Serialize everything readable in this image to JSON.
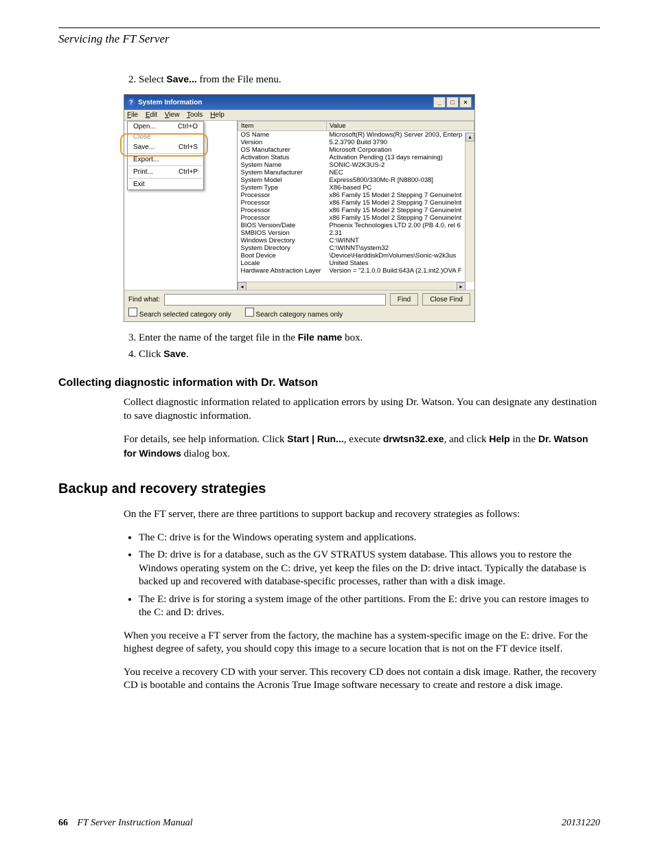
{
  "running_head": "Servicing the FT Server",
  "step2_prefix": "Select ",
  "step2_bold": "Save...",
  "step2_suffix": " from the File menu.",
  "screenshot": {
    "title": "System Information",
    "menus": [
      "File",
      "Edit",
      "View",
      "Tools",
      "Help"
    ],
    "file_menu": [
      {
        "label": "Open...",
        "accel": "Ctrl+O",
        "disabled": false
      },
      {
        "label": "Close",
        "accel": "",
        "disabled": true
      },
      {
        "label": "Save...",
        "accel": "Ctrl+S",
        "disabled": false
      },
      {
        "label": "Export...",
        "accel": "",
        "disabled": false
      },
      {
        "label": "Print...",
        "accel": "Ctrl+P",
        "disabled": false
      },
      {
        "label": "Exit",
        "accel": "",
        "disabled": false
      }
    ],
    "columns": [
      "Item",
      "Value"
    ],
    "rows": [
      [
        "OS Name",
        "Microsoft(R) Windows(R) Server 2003, Enterp"
      ],
      [
        "Version",
        "5.2.3790 Build 3790"
      ],
      [
        "OS Manufacturer",
        "Microsoft Corporation"
      ],
      [
        "Activation Status",
        "Activation Pending (13 days remaining)"
      ],
      [
        "System Name",
        "SONIC-W2K3US-2"
      ],
      [
        "System Manufacturer",
        "NEC"
      ],
      [
        "System Model",
        "Express5800/330Mc-R [N8800-038]"
      ],
      [
        "System Type",
        "X86-based PC"
      ],
      [
        "Processor",
        "x86 Family 15 Model 2 Stepping 7 GenuineInt"
      ],
      [
        "Processor",
        "x86 Family 15 Model 2 Stepping 7 GenuineInt"
      ],
      [
        "Processor",
        "x86 Family 15 Model 2 Stepping 7 GenuineInt"
      ],
      [
        "Processor",
        "x86 Family 15 Model 2 Stepping 7 GenuineInt"
      ],
      [
        "BIOS Version/Date",
        "Phoenix Technologies LTD 2.00 (PB 4.0, rel 6"
      ],
      [
        "SMBIOS Version",
        "2.31"
      ],
      [
        "Windows Directory",
        "C:\\WINNT"
      ],
      [
        "System Directory",
        "C:\\WINNT\\system32"
      ],
      [
        "Boot Device",
        "\\Device\\HarddiskDmVolumes\\Sonic-w2k3us"
      ],
      [
        "Locale",
        "United States"
      ],
      [
        "Hardware Abstraction Layer",
        "Version = \"2.1.0.0 Build:643A (2.1.int2.)OVA F"
      ]
    ],
    "find_label": "Find what:",
    "find_btn": "Find",
    "close_find_btn": "Close Find",
    "chk1": "Search selected category only",
    "chk2": "Search category names only"
  },
  "step3_prefix": "Enter the name of the target file in the ",
  "step3_bold": "File name",
  "step3_suffix": " box.",
  "step4_prefix": "Click ",
  "step4_bold": "Save",
  "step4_suffix": ".",
  "h3": "Collecting diagnostic information with Dr. Watson",
  "drwatson_p1": "Collect diagnostic information related to application errors by using Dr. Watson. You can designate any destination to save diagnostic information.",
  "drwatson_p2_a": "For details, see help information. Click ",
  "drwatson_p2_b": "Start | Run...",
  "drwatson_p2_c": ", execute ",
  "drwatson_p2_d": "drwtsn32.exe",
  "drwatson_p2_e": ", and click ",
  "drwatson_p2_f": "Help",
  "drwatson_p2_g": " in the ",
  "drwatson_p2_h": "Dr. Watson for Windows",
  "drwatson_p2_i": " dialog box.",
  "h2": "Backup and recovery strategies",
  "backup_intro": "On the FT server, there are three partitions to support backup and recovery strategies as follows:",
  "bullets": [
    "The C: drive is for the Windows operating system and applications.",
    "The D: drive is for a database, such as the GV STRATUS system database. This allows you to restore the Windows operating system on the C: drive, yet keep the files on the D: drive intact. Typically the database is backed up and recovered with database-specific processes, rather than with a disk image.",
    "The E: drive is for storing a system image of the other partitions. From the E: drive you can restore images to the C: and D: drives."
  ],
  "backup_p2": "When you receive a FT server from the factory, the machine has a system-specific image on the E: drive. For the highest degree of safety, you should copy this image to a secure location that is not on the FT device itself.",
  "backup_p3": "You receive a recovery CD with your server. This recovery CD does not contain a disk image. Rather, the recovery CD is bootable and contains the Acronis True Image software necessary to create and restore a disk image.",
  "footer_page": "66",
  "footer_title": "FT Server Instruction Manual",
  "footer_date": "20131220"
}
